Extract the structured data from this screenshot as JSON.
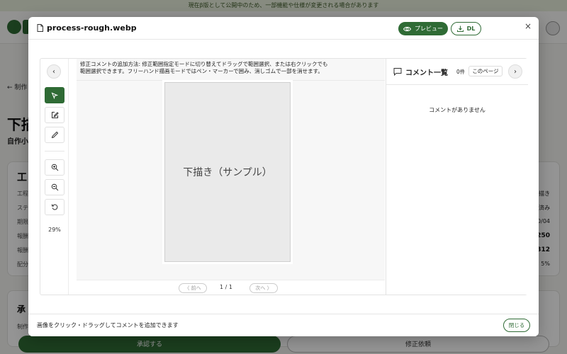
{
  "banner": {
    "text": "現在β版として公開中のため、一部機能や仕様が変更される場合があります"
  },
  "background": {
    "back_label": "← 制作",
    "title": "下描",
    "subtitle": "自作小",
    "card_title": "工",
    "rows": [
      {
        "label": "工程",
        "value": "描き",
        "strong": false
      },
      {
        "label": "ステ",
        "value": "済み",
        "strong": false
      },
      {
        "label": "期限",
        "value": "0/04",
        "strong": false
      },
      {
        "label": "報酬",
        "value": "250",
        "strong": true
      },
      {
        "label": "報酬",
        "value": "312",
        "strong": true
      },
      {
        "label": "配分",
        "value": "5%",
        "strong": false
      }
    ],
    "card2_title": "承",
    "card2_line": "制作",
    "approve_label": "承認する",
    "revision_label": "修正依頼"
  },
  "modal": {
    "file_name": "process-rough.webp",
    "preview_label": "プレビュー",
    "download_label": "DL",
    "close_icon_glyph": "×",
    "help_line1": "修正コメントの追加方法: 修正範囲指定モードに切り替えてドラッグで範囲選択、または右クリックでも",
    "help_line2": "範囲選択できます。フリーハンド描画モードではペン・マーカーで囲み、消しゴムで一部を消せます。",
    "zoom_level": "29%",
    "image_placeholder": "下描き（サンプル）",
    "pager": {
      "prev": "〈 前へ",
      "next": "次へ 〉",
      "label": "1 / 1"
    },
    "comments": {
      "title": "コメント一覧",
      "count": "0件",
      "filter": "このページ",
      "empty": "コメントがありません"
    },
    "footer_hint": "画像をクリック・ドラッグしてコメントを追加できます",
    "close_label": "閉じる"
  },
  "colors": {
    "accent": "#2f6b35",
    "banner_bg": "#e8f0dc"
  }
}
